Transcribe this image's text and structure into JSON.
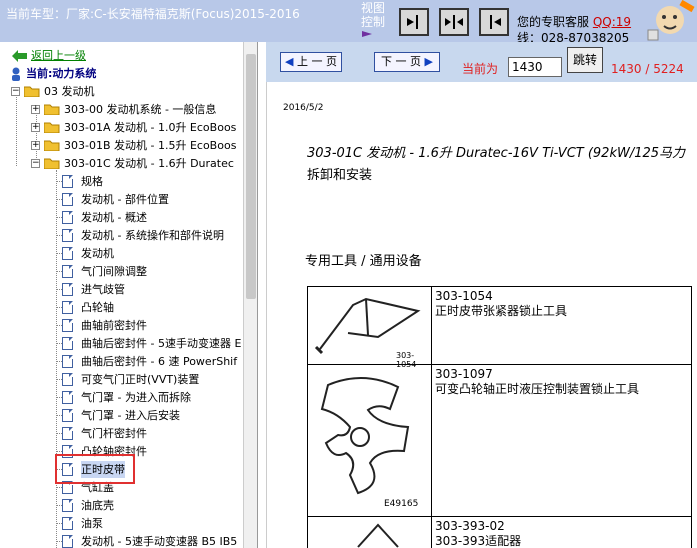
{
  "header": {
    "car_model": "当前车型：厂家:C-长安福特福克斯(Focus)2015-2016",
    "view_control_line1": "视图",
    "view_control_line2": "控制",
    "support_text": "您的专职客服",
    "support_qq": "QQ:19",
    "phone": "线：028-87038205"
  },
  "tree": {
    "back_link": "返回上一级",
    "current_system": "当前:动力系统",
    "root": "03 发动机",
    "folders": [
      {
        "label": "303-00 发动机系统 - 一般信息"
      },
      {
        "label": "303-01A 发动机 - 1.0升 EcoBoos"
      },
      {
        "label": "303-01B 发动机 - 1.5升 EcoBoos"
      },
      {
        "label": "303-01C 发动机 - 1.6升 Duratec"
      }
    ],
    "items": [
      {
        "label": "规格"
      },
      {
        "label": "发动机 - 部件位置"
      },
      {
        "label": "发动机 - 概述"
      },
      {
        "label": "发动机 - 系统操作和部件说明"
      },
      {
        "label": "发动机"
      },
      {
        "label": "气门间隙调整"
      },
      {
        "label": "进气歧管"
      },
      {
        "label": "凸轮轴"
      },
      {
        "label": "曲轴前密封件"
      },
      {
        "label": "曲轴后密封件 - 5速手动变速器 E"
      },
      {
        "label": "曲轴后密封件 - 6 速 PowerShif"
      },
      {
        "label": "可变气门正时(VVT)装置"
      },
      {
        "label": "气门罩 - 为进入而拆除"
      },
      {
        "label": "气门罩 - 进入后安装"
      },
      {
        "label": "气门杆密封件"
      },
      {
        "label": "凸轮轴密封件"
      },
      {
        "label": "正时皮带"
      },
      {
        "label": "气缸盖"
      },
      {
        "label": "油底壳"
      },
      {
        "label": "油泵"
      },
      {
        "label": "发动机 - 5速手动变速器 B5 IB5"
      }
    ]
  },
  "nav": {
    "prev_label": "上 一 页",
    "next_label": "下 一 页",
    "current_label": "当前为",
    "page_value": "1430",
    "jump_label": "跳转",
    "page_count": "1430 / 5224"
  },
  "document": {
    "date": "2016/5/2",
    "title": "303-01C 发动机 - 1.6升 Duratec-16V Ti-VCT (92kW/125马力",
    "subtitle": "拆卸和安装",
    "section": "专用工具 / 通用设备",
    "tools": [
      {
        "code": "303-1054",
        "name": "正时皮带张紧器锁止工具",
        "pic_label": "303-1054"
      },
      {
        "code": "303-1097",
        "name": "可变凸轮轴正时液压控制装置锁止工具",
        "pic_label": "E49165"
      },
      {
        "code": "303-393-02",
        "name": "303-393适配器",
        "pic_label": ""
      }
    ]
  },
  "colors": {
    "header_bg": "#b8c8e8",
    "nav_bg": "#c8d8ee",
    "highlight_red": "#e03030",
    "page_red": "#e02020"
  }
}
